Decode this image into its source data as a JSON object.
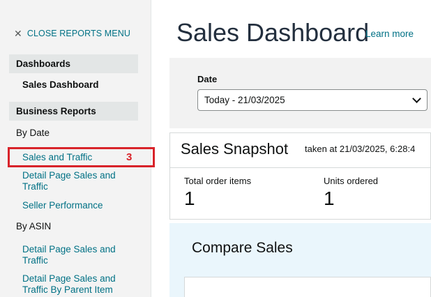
{
  "sidebar": {
    "close_label": "CLOSE REPORTS MENU",
    "dashboards_header": "Dashboards",
    "sales_dashboard": "Sales Dashboard",
    "business_reports_header": "Business Reports",
    "by_date_group": "By Date",
    "by_date_items": [
      "Sales and Traffic",
      "Detail Page Sales and Traffic",
      "Seller Performance"
    ],
    "by_asin_group": "By ASIN",
    "by_asin_items": [
      "Detail Page Sales and Traffic",
      "Detail Page Sales and Traffic By Parent Item"
    ],
    "annotation_number": "3"
  },
  "main": {
    "title": "Sales Dashboard",
    "learn_more": "Learn more",
    "date_label": "Date",
    "date_value": "Today - 21/03/2025",
    "snapshot_title": "Sales Snapshot",
    "snapshot_taken": "taken at 21/03/2025, 6:28:4",
    "metrics": [
      {
        "label": "Total order items",
        "value": "1"
      },
      {
        "label": "Units ordered",
        "value": "1"
      }
    ],
    "compare_title": "Compare Sales"
  },
  "colors": {
    "link": "#007185",
    "highlight": "#d8232a",
    "sidebar_bg": "#f3f3f3",
    "compare_bg": "#eaf6fc"
  }
}
